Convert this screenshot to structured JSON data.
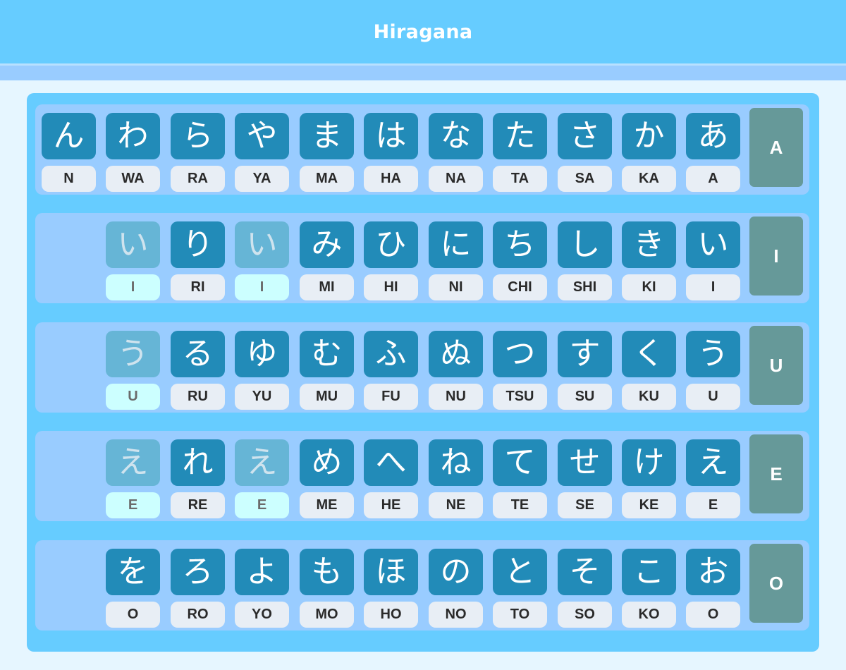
{
  "header": {
    "title": "Hiragana"
  },
  "colors": {
    "header_bg": "#66ccff",
    "subbar_bg": "#99ccff",
    "page_bg": "#e6f6ff",
    "panel_bg": "#66ccff",
    "row_bg": "#99ccff",
    "kana_bg": "#228bb8",
    "kana_ghost_bg": "#66b5d6",
    "romaji_bg": "#e8eef5",
    "romaji_ghost_bg": "#ccffff",
    "vowel_bg": "#669999"
  },
  "rows": [
    {
      "vowel": "A",
      "cells": [
        {
          "kana": "ん",
          "romaji": "N",
          "ghost": false
        },
        {
          "kana": "わ",
          "romaji": "WA",
          "ghost": false
        },
        {
          "kana": "ら",
          "romaji": "RA",
          "ghost": false
        },
        {
          "kana": "や",
          "romaji": "YA",
          "ghost": false
        },
        {
          "kana": "ま",
          "romaji": "MA",
          "ghost": false
        },
        {
          "kana": "は",
          "romaji": "HA",
          "ghost": false
        },
        {
          "kana": "な",
          "romaji": "NA",
          "ghost": false
        },
        {
          "kana": "た",
          "romaji": "TA",
          "ghost": false
        },
        {
          "kana": "さ",
          "romaji": "SA",
          "ghost": false
        },
        {
          "kana": "か",
          "romaji": "KA",
          "ghost": false
        },
        {
          "kana": "あ",
          "romaji": "A",
          "ghost": false
        }
      ]
    },
    {
      "vowel": "I",
      "cells": [
        null,
        {
          "kana": "い",
          "romaji": "I",
          "ghost": true
        },
        {
          "kana": "り",
          "romaji": "RI",
          "ghost": false
        },
        {
          "kana": "い",
          "romaji": "I",
          "ghost": true
        },
        {
          "kana": "み",
          "romaji": "MI",
          "ghost": false
        },
        {
          "kana": "ひ",
          "romaji": "HI",
          "ghost": false
        },
        {
          "kana": "に",
          "romaji": "NI",
          "ghost": false
        },
        {
          "kana": "ち",
          "romaji": "CHI",
          "ghost": false
        },
        {
          "kana": "し",
          "romaji": "SHI",
          "ghost": false
        },
        {
          "kana": "き",
          "romaji": "KI",
          "ghost": false
        },
        {
          "kana": "い",
          "romaji": "I",
          "ghost": false
        }
      ]
    },
    {
      "vowel": "U",
      "cells": [
        null,
        {
          "kana": "う",
          "romaji": "U",
          "ghost": true
        },
        {
          "kana": "る",
          "romaji": "RU",
          "ghost": false
        },
        {
          "kana": "ゆ",
          "romaji": "YU",
          "ghost": false
        },
        {
          "kana": "む",
          "romaji": "MU",
          "ghost": false
        },
        {
          "kana": "ふ",
          "romaji": "FU",
          "ghost": false
        },
        {
          "kana": "ぬ",
          "romaji": "NU",
          "ghost": false
        },
        {
          "kana": "つ",
          "romaji": "TSU",
          "ghost": false
        },
        {
          "kana": "す",
          "romaji": "SU",
          "ghost": false
        },
        {
          "kana": "く",
          "romaji": "KU",
          "ghost": false
        },
        {
          "kana": "う",
          "romaji": "U",
          "ghost": false
        }
      ]
    },
    {
      "vowel": "E",
      "cells": [
        null,
        {
          "kana": "え",
          "romaji": "E",
          "ghost": true
        },
        {
          "kana": "れ",
          "romaji": "RE",
          "ghost": false
        },
        {
          "kana": "え",
          "romaji": "E",
          "ghost": true
        },
        {
          "kana": "め",
          "romaji": "ME",
          "ghost": false
        },
        {
          "kana": "へ",
          "romaji": "HE",
          "ghost": false
        },
        {
          "kana": "ね",
          "romaji": "NE",
          "ghost": false
        },
        {
          "kana": "て",
          "romaji": "TE",
          "ghost": false
        },
        {
          "kana": "せ",
          "romaji": "SE",
          "ghost": false
        },
        {
          "kana": "け",
          "romaji": "KE",
          "ghost": false
        },
        {
          "kana": "え",
          "romaji": "E",
          "ghost": false
        }
      ]
    },
    {
      "vowel": "O",
      "cells": [
        null,
        {
          "kana": "を",
          "romaji": "O",
          "ghost": false
        },
        {
          "kana": "ろ",
          "romaji": "RO",
          "ghost": false
        },
        {
          "kana": "よ",
          "romaji": "YO",
          "ghost": false
        },
        {
          "kana": "も",
          "romaji": "MO",
          "ghost": false
        },
        {
          "kana": "ほ",
          "romaji": "HO",
          "ghost": false
        },
        {
          "kana": "の",
          "romaji": "NO",
          "ghost": false
        },
        {
          "kana": "と",
          "romaji": "TO",
          "ghost": false
        },
        {
          "kana": "そ",
          "romaji": "SO",
          "ghost": false
        },
        {
          "kana": "こ",
          "romaji": "KO",
          "ghost": false
        },
        {
          "kana": "お",
          "romaji": "O",
          "ghost": false
        }
      ]
    }
  ]
}
